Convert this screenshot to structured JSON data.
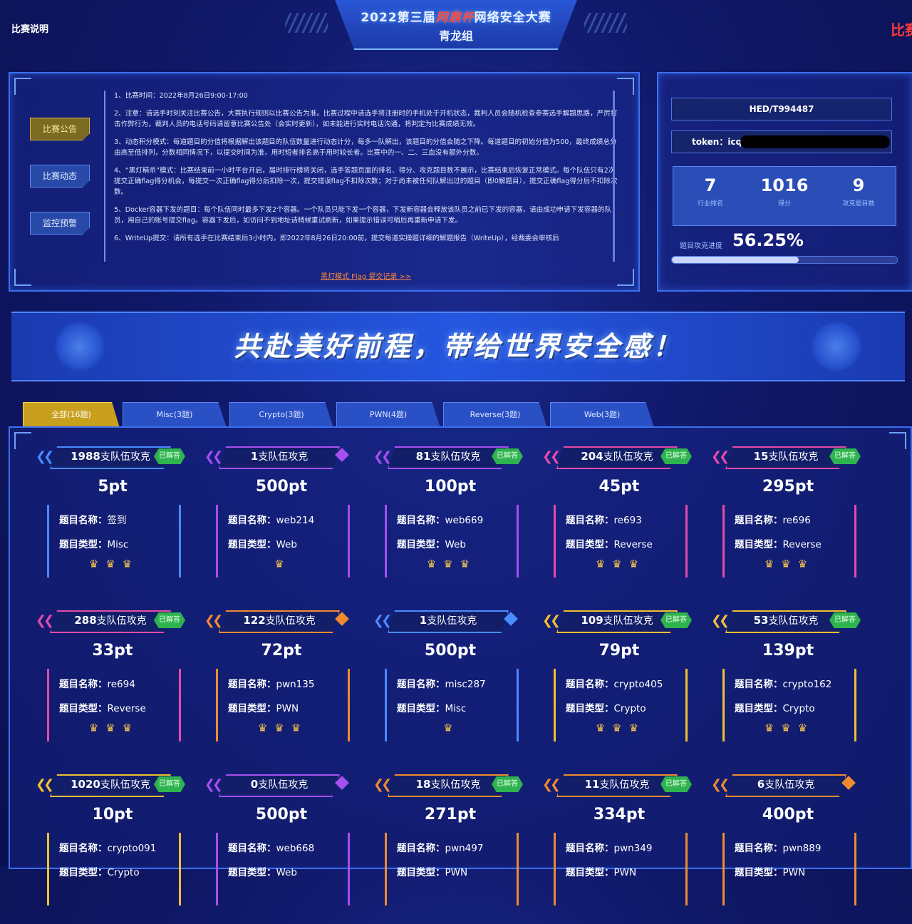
{
  "header": {
    "left_link": "比赛说明",
    "right_link": "比赛",
    "title_pre": "2022第三届",
    "title_brand": "网鼎杯",
    "title_post": "网络安全大赛",
    "subtitle": "青龙组"
  },
  "notice": {
    "tabs": [
      "比赛公告",
      "比赛动态",
      "监控预警"
    ],
    "active_tab": 0,
    "paragraphs": [
      "1、比赛时间：2022年8月26日9:00-17:00",
      "2、注意：请选手时刻关注比赛公告，大赛执行规则以比赛公告为准。比赛过程中请选手将注册时的手机处于开机状态，裁判人员会随机检查参赛选手解题思路，严厉打击作弊行为，裁判人员的电话号码请留意比赛公告处（会实时更新），如未能进行实时电话沟通，将判定为比赛成绩无效。",
      "3、动态积分模式：每道题目的分值将根据解出该题目的队伍数量进行动态计分，每多一队解出，该题目的分值会随之下降。每道题目的初始分值为500，最终成绩总分由高至低排列，分数相同情况下，以提交时间为准，用时短者排名高于用时较长者。比赛中的一、二、三血没有额外分数。",
      "4、“黑灯精杀”模式：比赛结束前一小时平台开启，届时排行榜将关闭，选手答题页面的排名、得分、攻克题目数不展示，比赛结束后恢复正常模式。每个队伍只有2次提交正确flag得分机会，每提交一次正确flag得分后扣除一次，提交错误flag不扣除次数；对于尚未被任何队解出过的题目（即0解题目），提交正确flag得分后不扣除次数。",
      "5、Docker容器下发的题目：每个队伍同时最多下发2个容器。一个队员只能下发一个容器，下发新容器会释放该队员之前已下发的容器，请由成功申请下发容器的队员，用自己的账号提交flag。容器下发后，如访问不到地址请稍候重试刷新，如果提示错误可稍后再重新申请下发。",
      "6、WriteUp提交：请所有选手在比赛结束后3小时内，即2022年8月26日20:00前，提交每道实操题详细的解题报告（WriteUp），经裁委会审核后"
    ],
    "link": "黑灯模式 Flag 提交记录 >>"
  },
  "team": {
    "id": "HED/T994487",
    "token_label": "token：icq",
    "stats": [
      {
        "num": "7",
        "cap": "行业排名"
      },
      {
        "num": "1016",
        "cap": "得分"
      },
      {
        "num": "9",
        "cap": "攻克题目数"
      }
    ],
    "progress_label": "题目攻克进度",
    "progress_value": "56.25%",
    "progress_fraction": 0.5625
  },
  "banner": {
    "text": "共赴美好前程，带给世界安全感！"
  },
  "tabs": [
    "全部(16题)",
    "Misc(3题)",
    "Crypto(3题)",
    "PWN(4题)",
    "Reverse(3题)",
    "Web(3题)"
  ],
  "active_tab": 0,
  "labels": {
    "name": "题目名称：",
    "type": "题目类型：",
    "solves_suffix": "支队伍攻克",
    "solved": "已解答"
  },
  "colors": {
    "accent_gold": "#c9a01e",
    "solved_green": "#2fb34f",
    "panel_blue": "#3c6ff0"
  },
  "challenges": [
    {
      "solves": "1988",
      "points": "5pt",
      "name": "签到",
      "type": "Misc",
      "solved": true,
      "crowns": "♛♛♛",
      "color": "#4a8bff"
    },
    {
      "solves": "1",
      "points": "500pt",
      "name": "web214",
      "type": "Web",
      "solved": false,
      "crowns": "♛",
      "color": "#a64ff0"
    },
    {
      "solves": "81",
      "points": "100pt",
      "name": "web669",
      "type": "Web",
      "solved": true,
      "crowns": "♛♛♛",
      "color": "#a64ff0"
    },
    {
      "solves": "204",
      "points": "45pt",
      "name": "re693",
      "type": "Reverse",
      "solved": true,
      "crowns": "♛♛♛",
      "color": "#e64aa8"
    },
    {
      "solves": "15",
      "points": "295pt",
      "name": "re696",
      "type": "Reverse",
      "solved": true,
      "crowns": "♛♛♛",
      "color": "#e64aa8"
    },
    {
      "solves": "288",
      "points": "33pt",
      "name": "re694",
      "type": "Reverse",
      "solved": true,
      "crowns": "♛♛♛",
      "color": "#e64aa8"
    },
    {
      "solves": "122",
      "points": "72pt",
      "name": "pwn135",
      "type": "PWN",
      "solved": false,
      "crowns": "♛♛♛",
      "color": "#f08a30"
    },
    {
      "solves": "1",
      "points": "500pt",
      "name": "misc287",
      "type": "Misc",
      "solved": false,
      "crowns": "♛",
      "color": "#4a8bff"
    },
    {
      "solves": "109",
      "points": "79pt",
      "name": "crypto405",
      "type": "Crypto",
      "solved": true,
      "crowns": "♛♛♛",
      "color": "#f0c030"
    },
    {
      "solves": "53",
      "points": "139pt",
      "name": "crypto162",
      "type": "Crypto",
      "solved": true,
      "crowns": "♛♛♛",
      "color": "#f0c030"
    },
    {
      "solves": "1020",
      "points": "10pt",
      "name": "crypto091",
      "type": "Crypto",
      "solved": true,
      "crowns": "",
      "color": "#f0c030"
    },
    {
      "solves": "0",
      "points": "500pt",
      "name": "web668",
      "type": "Web",
      "solved": false,
      "crowns": "",
      "color": "#a64ff0"
    },
    {
      "solves": "18",
      "points": "271pt",
      "name": "pwn497",
      "type": "PWN",
      "solved": true,
      "crowns": "",
      "color": "#f08a30"
    },
    {
      "solves": "11",
      "points": "334pt",
      "name": "pwn349",
      "type": "PWN",
      "solved": true,
      "crowns": "",
      "color": "#f08a30"
    },
    {
      "solves": "6",
      "points": "400pt",
      "name": "pwn889",
      "type": "PWN",
      "solved": false,
      "crowns": "",
      "color": "#f08a30"
    }
  ]
}
